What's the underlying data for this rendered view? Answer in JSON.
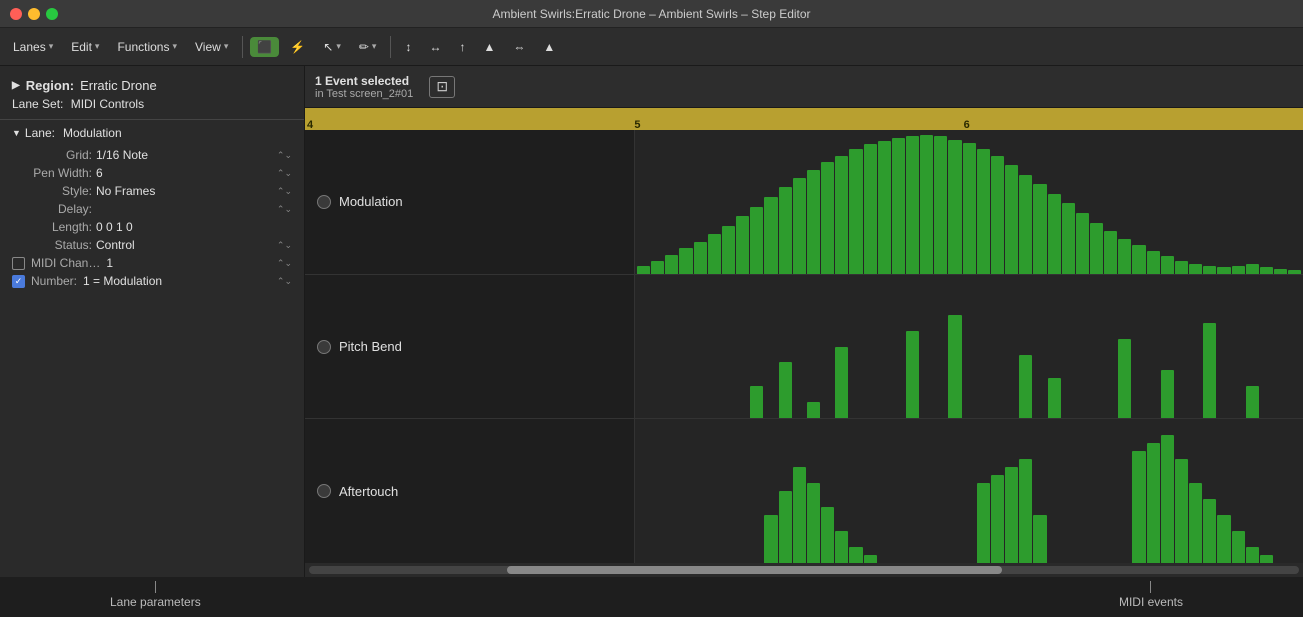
{
  "window": {
    "title": "Ambient Swirls:Erratic Drone – Ambient Swirls – Step Editor"
  },
  "toolbar": {
    "lanes_label": "Lanes",
    "edit_label": "Edit",
    "functions_label": "Functions",
    "view_label": "View"
  },
  "left_panel": {
    "region_label": "Region:",
    "region_name": "Erratic Drone",
    "lane_set_label": "Lane Set:",
    "lane_set_name": "MIDI Controls",
    "lane_label": "Lane:",
    "lane_name": "Modulation",
    "params": {
      "grid_label": "Grid:",
      "grid_value": "1/16 Note",
      "pen_width_label": "Pen Width:",
      "pen_width_value": "6",
      "style_label": "Style:",
      "style_value": "No Frames",
      "delay_label": "Delay:",
      "delay_value": "",
      "length_label": "Length:",
      "length_value": "0  0  1     0",
      "status_label": "Status:",
      "status_value": "Control",
      "midi_chan_label": "MIDI Chan…",
      "midi_chan_value": "1",
      "number_label": "Number:",
      "number_value": "1 = Modulation"
    }
  },
  "event_bar": {
    "title": "1 Event selected",
    "subtitle": "in Test screen_2#01"
  },
  "timeline": {
    "markers": [
      "4",
      "5",
      "6"
    ]
  },
  "lanes": [
    {
      "name": "Modulation",
      "bars": [
        5,
        8,
        12,
        16,
        20,
        25,
        30,
        36,
        42,
        48,
        54,
        60,
        65,
        70,
        74,
        78,
        81,
        83,
        85,
        86,
        87,
        86,
        84,
        82,
        78,
        74,
        68,
        62,
        56,
        50,
        44,
        38,
        32,
        27,
        22,
        18,
        14,
        11,
        8,
        6,
        5,
        4,
        5,
        6,
        4,
        3,
        2
      ]
    },
    {
      "name": "Pitch Bend",
      "bars": [
        0,
        0,
        0,
        0,
        0,
        0,
        0,
        0,
        20,
        0,
        35,
        0,
        10,
        0,
        45,
        0,
        0,
        0,
        0,
        55,
        0,
        0,
        65,
        0,
        0,
        0,
        0,
        40,
        0,
        25,
        0,
        0,
        0,
        0,
        50,
        0,
        0,
        30,
        0,
        0,
        60,
        0,
        0,
        20,
        0,
        0,
        0
      ]
    },
    {
      "name": "Aftertouch",
      "bars": [
        0,
        0,
        0,
        0,
        0,
        0,
        0,
        0,
        0,
        30,
        45,
        60,
        50,
        35,
        20,
        10,
        5,
        0,
        0,
        0,
        0,
        0,
        0,
        0,
        50,
        55,
        60,
        65,
        30,
        0,
        0,
        0,
        0,
        0,
        0,
        70,
        75,
        80,
        65,
        50,
        40,
        30,
        20,
        10,
        5,
        0,
        0
      ]
    }
  ],
  "annotations": {
    "lane_params": "Lane parameters",
    "midi_events": "MIDI events"
  }
}
